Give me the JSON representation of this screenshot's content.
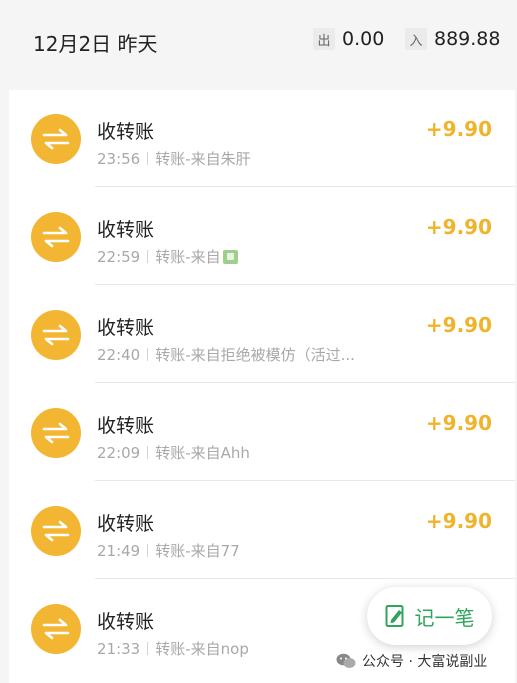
{
  "header": {
    "date": "12月2日 昨天",
    "out_tag": "出",
    "out_amount": "0.00",
    "in_tag": "入",
    "in_amount": "889.88"
  },
  "items": [
    {
      "title": "收转账",
      "time": "23:56",
      "source": "转账-来自朱肝",
      "amount": "+9.90"
    },
    {
      "title": "收转账",
      "time": "22:59",
      "source": "转账-来自",
      "amount": "+9.90"
    },
    {
      "title": "收转账",
      "time": "22:40",
      "source": "转账-来自拒绝被模仿（活过...",
      "amount": "+9.90"
    },
    {
      "title": "收转账",
      "time": "22:09",
      "source": "转账-来自Ahh",
      "amount": "+9.90"
    },
    {
      "title": "收转账",
      "time": "21:49",
      "source": "转账-来自77",
      "amount": "+9.90"
    },
    {
      "title": "收转账",
      "time": "21:33",
      "source": "转账-来自nop",
      "amount": ""
    }
  ],
  "fab": {
    "label": "记一笔"
  },
  "watermark": {
    "text": "公众号 · 大富说副业"
  },
  "colors": {
    "accent": "#f3b633",
    "amount": "#f0b32c",
    "fab_green": "#2fa45a"
  },
  "icons": {
    "row": "transfer-arrows-icon",
    "fab": "edit-note-icon",
    "watermark": "wechat-icon",
    "source_avatar": "contact-avatar-icon"
  }
}
